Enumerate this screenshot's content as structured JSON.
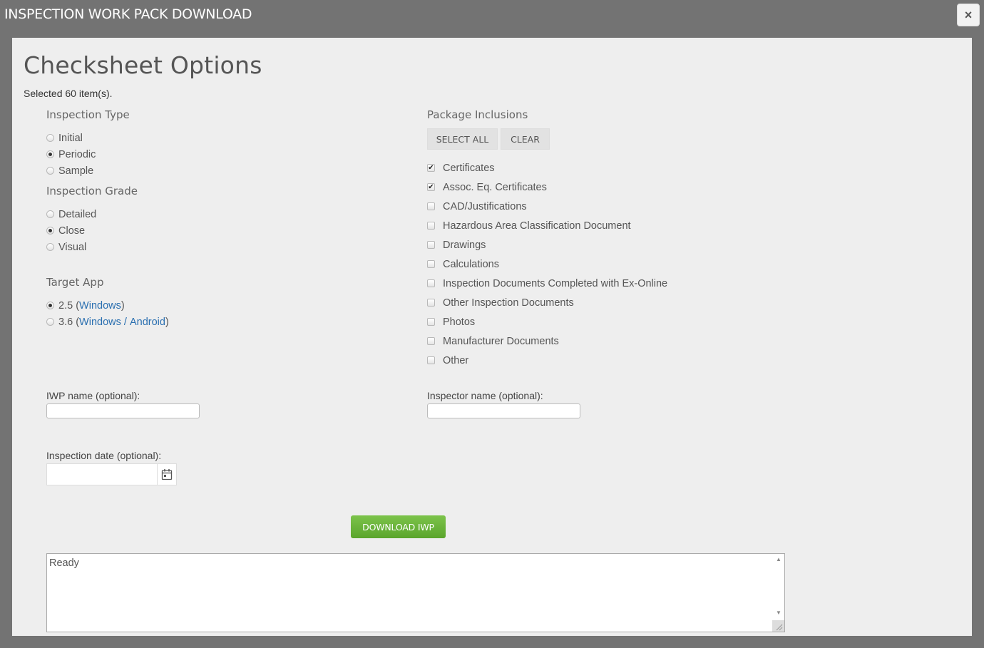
{
  "window": {
    "title": "INSPECTION WORK PACK DOWNLOAD",
    "close_label": "×"
  },
  "main": {
    "heading": "Checksheet Options",
    "selected_text": "Selected 60 item(s)."
  },
  "inspection_type": {
    "label": "Inspection Type",
    "options": [
      {
        "label": "Initial",
        "selected": false
      },
      {
        "label": "Periodic",
        "selected": true
      },
      {
        "label": "Sample",
        "selected": false
      }
    ]
  },
  "inspection_grade": {
    "label": "Inspection Grade",
    "options": [
      {
        "label": "Detailed",
        "selected": false
      },
      {
        "label": "Close",
        "selected": true
      },
      {
        "label": "Visual",
        "selected": false
      }
    ]
  },
  "target_app": {
    "label": "Target App",
    "options": [
      {
        "version": "2.5",
        "open": " (",
        "link1": "Windows",
        "sep": "",
        "link2": "",
        "close": ")",
        "selected": true
      },
      {
        "version": "3.6",
        "open": " (",
        "link1": "Windows",
        "sep": " / ",
        "link2": "Android",
        "close": ")",
        "selected": false
      }
    ]
  },
  "package_inclusions": {
    "label": "Package Inclusions",
    "select_all_label": "SELECT ALL",
    "clear_label": "CLEAR",
    "items": [
      {
        "label": "Certificates",
        "checked": true
      },
      {
        "label": "Assoc. Eq. Certificates",
        "checked": true
      },
      {
        "label": "CAD/Justifications",
        "checked": false
      },
      {
        "label": "Hazardous Area Classification Document",
        "checked": false
      },
      {
        "label": "Drawings",
        "checked": false
      },
      {
        "label": "Calculations",
        "checked": false
      },
      {
        "label": "Inspection Documents Completed with Ex-Online",
        "checked": false
      },
      {
        "label": "Other Inspection Documents",
        "checked": false
      },
      {
        "label": "Photos",
        "checked": false
      },
      {
        "label": "Manufacturer Documents",
        "checked": false
      },
      {
        "label": "Other",
        "checked": false
      }
    ]
  },
  "fields": {
    "iwp_name_label": "IWP name (optional):",
    "iwp_name_value": "",
    "inspector_name_label": "Inspector name (optional):",
    "inspector_name_value": "",
    "inspection_date_label": "Inspection date (optional):",
    "inspection_date_value": ""
  },
  "actions": {
    "download_label": "DOWNLOAD IWP"
  },
  "status": {
    "text": "Ready"
  },
  "icons": {
    "calendar": "calendar-icon",
    "close": "close-icon"
  }
}
